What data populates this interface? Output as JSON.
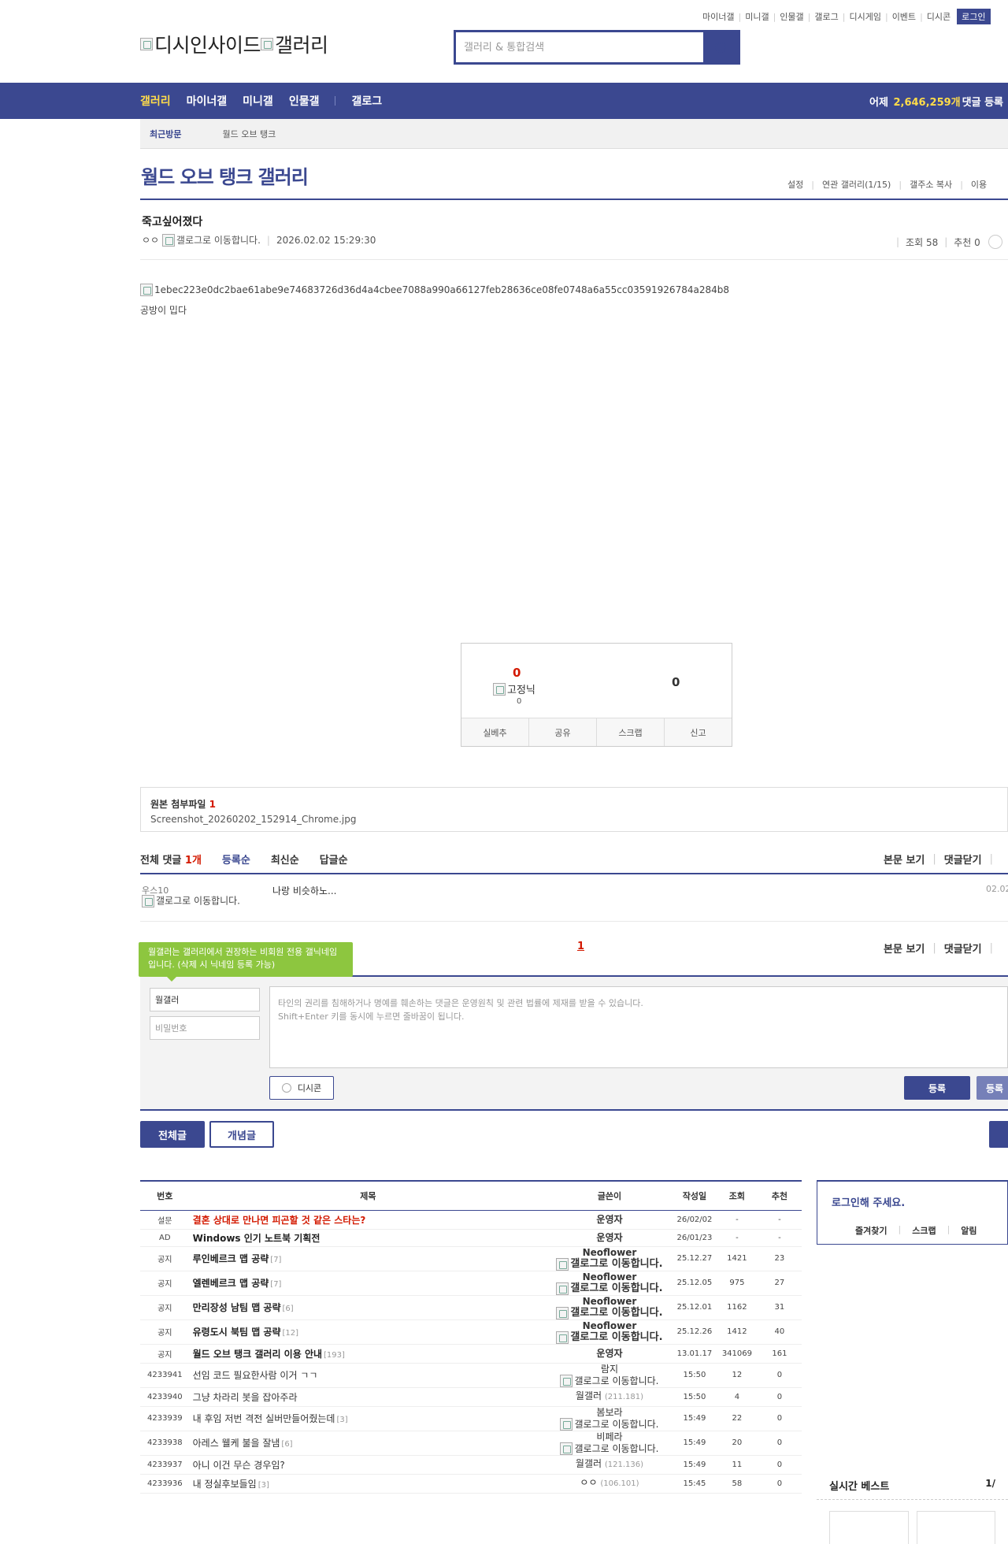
{
  "header": {
    "top_links": [
      "마이너갤",
      "미니갤",
      "인물갤",
      "갤로그",
      "디시게임",
      "이벤트",
      "디시콘"
    ],
    "login_label": "로그인",
    "logo_text_1": "디시인사이드",
    "logo_text_2": "갤러리",
    "search_placeholder": "갤러리 & 통합검색"
  },
  "nav": {
    "items": [
      "갤러리",
      "마이너갤",
      "미니갤",
      "인물갤",
      "갤로그"
    ],
    "stat_prefix": "어제",
    "stat_count": "2,646,259개",
    "stat_suffix": "댓글 등록"
  },
  "recent": {
    "label": "최근방문",
    "value": "월드 오브 탱크"
  },
  "gallery": {
    "title": "월드 오브 탱크 갤러리",
    "links": [
      "설정",
      "연관 갤러리(1/15)",
      "갤주소 복사",
      "이용"
    ]
  },
  "post": {
    "title": "죽고싶어졌다",
    "author": "ㅇㅇ",
    "author_icon_alt": "갤로그로 이동합니다.",
    "datetime": "2026.02.02 15:29:30",
    "views": "조회 58",
    "recommend": "추천 0",
    "image_alt": "1ebec223e0dc2bae61abe9e74683726d36d4a4cbee7088a990a66127feb28636ce08fe0748a6a55cc03591926784a284b8",
    "text": "공방이 밉다"
  },
  "recommend_box": {
    "up_count": "0",
    "fix_alt": "고정닉",
    "fix_count": "0",
    "down_count": "0",
    "actions": [
      "실베추",
      "공유",
      "스크랩",
      "신고"
    ]
  },
  "attachment": {
    "head": "원본 첨부파일",
    "count": "1",
    "file": "Screenshot_20260202_152914_Chrome.jpg"
  },
  "comments": {
    "total_label": "전체 댓글",
    "total_count": "1개",
    "sort_tabs": [
      "등록순",
      "최신순",
      "답글순"
    ],
    "right_links": [
      "본문 보기",
      "댓글닫기"
    ],
    "items": [
      {
        "nick": "우스10",
        "nick_icon_alt": "갤로그로 이동합니다.",
        "text": "나랑 비슷하노...",
        "date": "02.02"
      }
    ],
    "page": "1"
  },
  "write": {
    "tooltip": "월갤러는 갤러리에서 권장하는 비회원 전용 갤닉네임입니다. (삭제 시 닉네임 등록 가능)",
    "nick_value": "월갤러",
    "password_placeholder": "비밀번호",
    "textarea_line1": "타인의 권리를 침해하거나 명예를 훼손하는 댓글은 운영원칙 및 관련 법률에 제재를 받을 수 있습니다.",
    "textarea_line2": "Shift+Enter 키를 동시에 누르면 줄바꿈이 됩니다.",
    "dccon_label": "디시콘",
    "submit_label": "등록",
    "submit2_label": "등록"
  },
  "list_tabs": {
    "all": "전체글",
    "concept": "개념글"
  },
  "list": {
    "headers": [
      "번호",
      "제목",
      "글쓴이",
      "작성일",
      "조회",
      "추천"
    ],
    "rows": [
      {
        "num": "설문",
        "title": "결혼 상대로 만나면 피곤할 것 같은 스타는?",
        "reply": "",
        "writer": "운영자",
        "ip": "",
        "date": "26/02/02",
        "views": "-",
        "rec": "-",
        "style": "red",
        "wstyle": "bold"
      },
      {
        "num": "AD",
        "title": "Windows 인기 노트북 기획전",
        "reply": "",
        "writer": "운영자",
        "ip": "",
        "date": "26/01/23",
        "views": "-",
        "rec": "-",
        "style": "bold",
        "wstyle": "bold"
      },
      {
        "num": "공지",
        "title": "루인베르크 맵 공략",
        "reply": "[7]",
        "writer": "Neoflower",
        "ip": "",
        "gallog": "갤로그로 이동합니다.",
        "date": "25.12.27",
        "views": "1421",
        "rec": "23",
        "style": "bold",
        "wstyle": "bold"
      },
      {
        "num": "공지",
        "title": "엘렌베르크 맵 공략",
        "reply": "[7]",
        "writer": "Neoflower",
        "ip": "",
        "gallog": "갤로그로 이동합니다.",
        "date": "25.12.05",
        "views": "975",
        "rec": "27",
        "style": "bold",
        "wstyle": "bold"
      },
      {
        "num": "공지",
        "title": "만리장성 남팀 맵 공략",
        "reply": "[6]",
        "writer": "Neoflower",
        "ip": "",
        "gallog": "갤로그로 이동합니다.",
        "date": "25.12.01",
        "views": "1162",
        "rec": "31",
        "style": "bold",
        "wstyle": "bold"
      },
      {
        "num": "공지",
        "title": "유령도시 북팀 맵 공략",
        "reply": "[12]",
        "writer": "Neoflower",
        "ip": "",
        "gallog": "갤로그로 이동합니다.",
        "date": "25.12.26",
        "views": "1412",
        "rec": "40",
        "style": "bold",
        "wstyle": "bold"
      },
      {
        "num": "공지",
        "title": "월드 오브 탱크 갤러리 이용 안내",
        "reply": "[193]",
        "writer": "운영자",
        "ip": "",
        "date": "13.01.17",
        "views": "341069",
        "rec": "161",
        "style": "bold",
        "wstyle": "bold"
      },
      {
        "num": "4233941",
        "title": "선임 코드 필요한사람 이거 ㄱㄱ",
        "reply": "",
        "writer": "람지",
        "ip": "",
        "gallog": "갤로그로 이동합니다.",
        "date": "15:50",
        "views": "12",
        "rec": "0",
        "style": "normal",
        "wstyle": "light"
      },
      {
        "num": "4233940",
        "title": "그냥 차라리 봇을 잡아주라",
        "reply": "",
        "writer": "월갤러",
        "ip": "(211.181)",
        "date": "15:50",
        "views": "4",
        "rec": "0",
        "style": "normal",
        "wstyle": "light"
      },
      {
        "num": "4233939",
        "title": "내 후임 저번 격전 실버만들어줬는데",
        "reply": "[3]",
        "writer": "봄보라",
        "ip": "",
        "gallog": "갤로그로 이동합니다.",
        "date": "15:49",
        "views": "22",
        "rec": "0",
        "style": "normal",
        "wstyle": "light"
      },
      {
        "num": "4233938",
        "title": "아레스 웰케 불을 잘냄",
        "reply": "[6]",
        "writer": "비페라",
        "ip": "",
        "gallog": "갤로그로 이동합니다.",
        "date": "15:49",
        "views": "20",
        "rec": "0",
        "style": "normal",
        "wstyle": "light"
      },
      {
        "num": "4233937",
        "title": "아니 이건 무슨 경우임?",
        "reply": "",
        "writer": "월갤러",
        "ip": "(121.136)",
        "date": "15:49",
        "views": "11",
        "rec": "0",
        "style": "normal",
        "wstyle": "light"
      },
      {
        "num": "4233936",
        "title": "내 정실후보들임",
        "reply": "[3]",
        "writer": "ㅇㅇ",
        "ip": "(106.101)",
        "date": "15:45",
        "views": "58",
        "rec": "0",
        "style": "normal",
        "wstyle": "light"
      }
    ]
  },
  "side": {
    "login_msg": "로그인해 주세요.",
    "login_links": [
      "즐겨찾기",
      "스크랩",
      "알림"
    ],
    "best_title": "실시간 베스트",
    "best_page": "1/"
  },
  "colors": {
    "brand": "#3b4890",
    "accent_red": "#d31900",
    "nav_active": "#ffdc4a",
    "tooltip_green": "#8dc63f"
  }
}
